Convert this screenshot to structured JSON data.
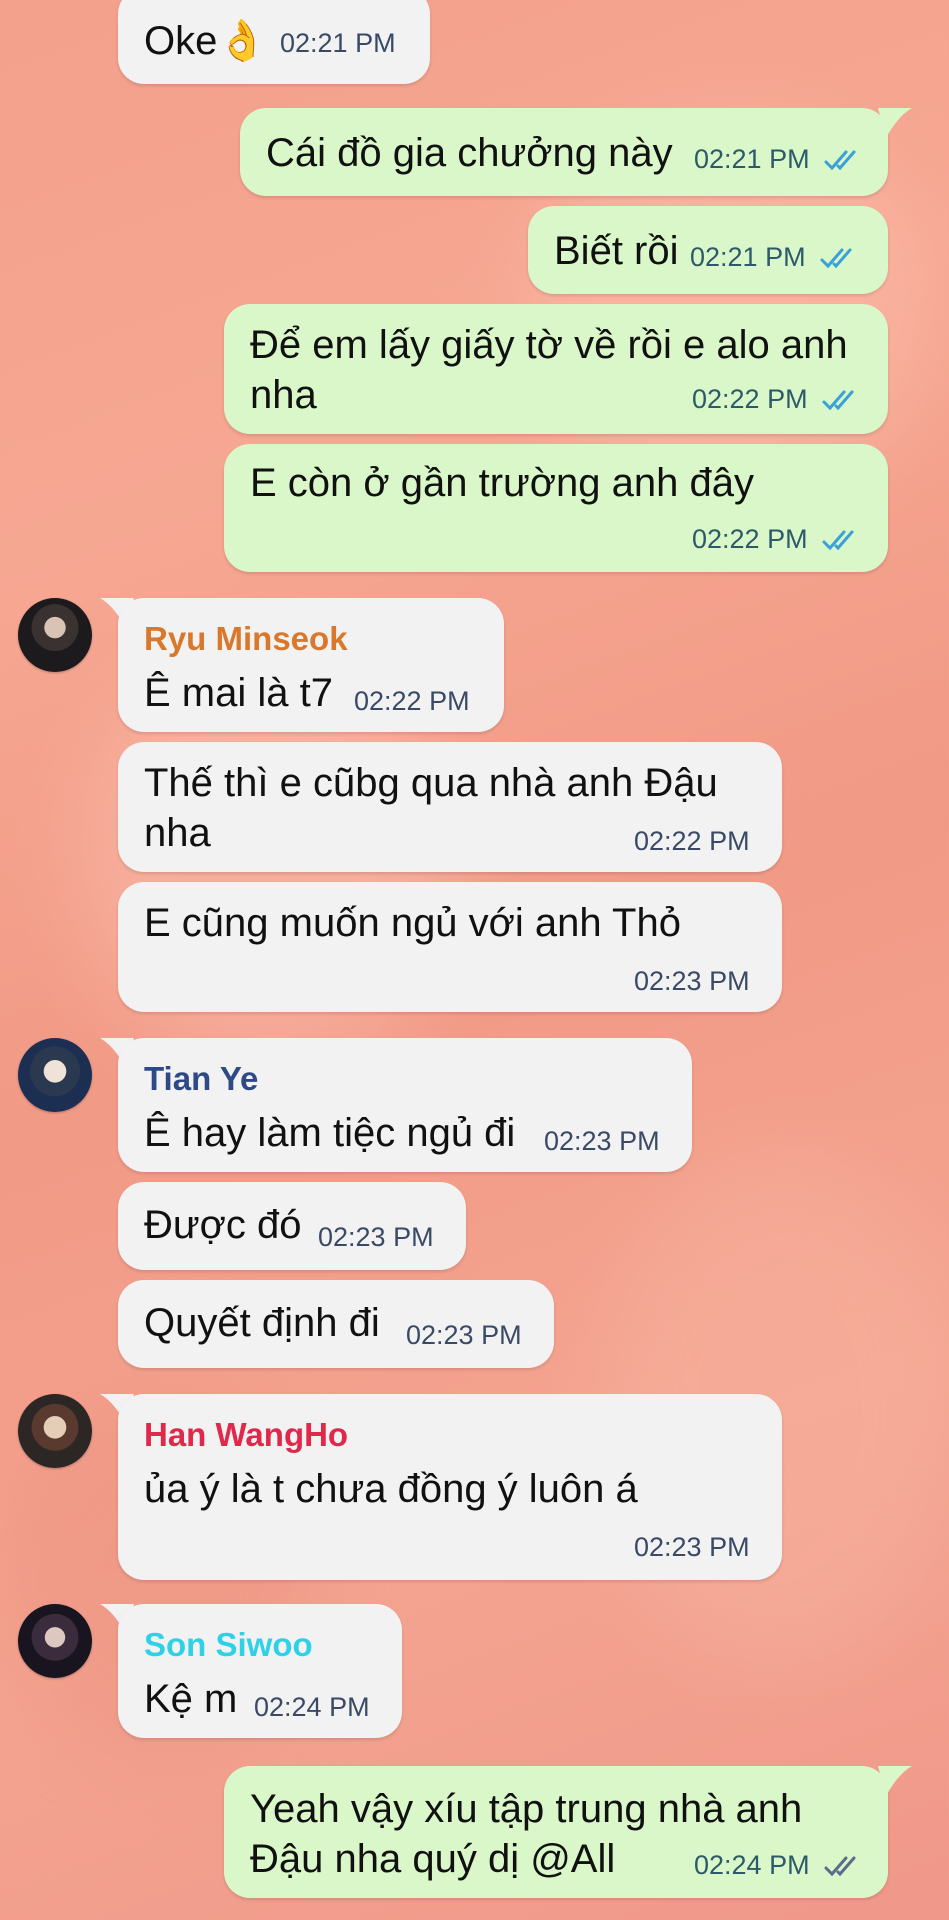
{
  "messages": [
    {
      "text": "Oke👌",
      "time": "02:21 PM"
    },
    {
      "text": "Cái đồ gia chưởng này",
      "time": "02:21 PM"
    },
    {
      "text": "Biết rồi",
      "time": "02:21 PM"
    },
    {
      "line1": "Để em lấy giấy tờ về rồi e alo anh",
      "line2": "nha",
      "time": "02:22 PM"
    },
    {
      "text": "E còn ở gần trường anh đây",
      "time": "02:22 PM"
    },
    {
      "sender": "Ryu Minseok",
      "text": "Ê mai là t7",
      "time": "02:22 PM"
    },
    {
      "line1": "Thế thì e cũbg qua nhà anh Đậu",
      "line2": "nha",
      "time": "02:22 PM"
    },
    {
      "text": "E cũng muốn ngủ với anh Thỏ",
      "time": "02:23 PM"
    },
    {
      "sender": "Tian Ye",
      "text": "Ê hay làm tiệc ngủ đi",
      "time": "02:23 PM"
    },
    {
      "text": "Được đó",
      "time": "02:23 PM"
    },
    {
      "text": "Quyết định đi",
      "time": "02:23 PM"
    },
    {
      "sender": "Han WangHo",
      "text": "ủa ý là t chưa đồng ý luôn á",
      "time": "02:23 PM"
    },
    {
      "sender": "Son Siwoo",
      "text": "Kệ m",
      "time": "02:24 PM"
    },
    {
      "line1": "Yeah vậy xíu tập trung nhà anh",
      "line2": "Đậu nha quý dị @All",
      "time": "02:24 PM"
    }
  ],
  "colors": {
    "ryu": "#d9772b",
    "tian": "#2d4a86",
    "han": "#e0284a",
    "son": "#2ed1e6",
    "tick_read": "#3aa0d8",
    "tick_sent": "#5a6c8a"
  },
  "icons": {
    "avatar": "avatar-icon",
    "read_receipt": "double-check-icon"
  }
}
